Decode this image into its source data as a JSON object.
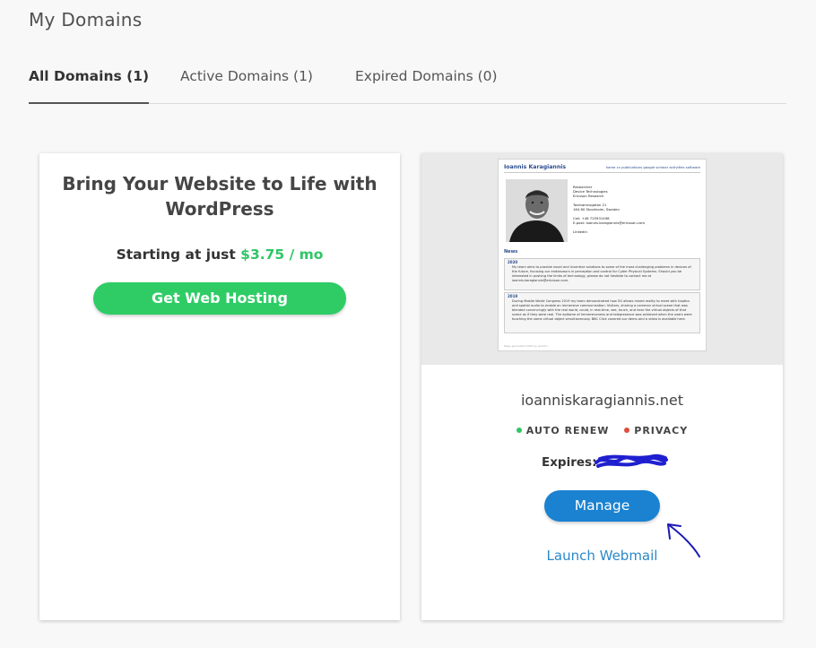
{
  "page": {
    "title": "My Domains"
  },
  "tabs": [
    {
      "label": "All Domains (1)",
      "active": true
    },
    {
      "label": "Active Domains (1)",
      "active": false
    },
    {
      "label": "Expired Domains (0)",
      "active": false
    }
  ],
  "promo": {
    "heading": "Bring Your Website to Life with WordPress",
    "price_prefix": "Starting at just",
    "price_amount": "$3.75 / mo",
    "button_label": "Get Web Hosting",
    "accent_color": "#2fcc66"
  },
  "domain_card": {
    "domain": "ioanniskaragiannis.net",
    "badges": [
      {
        "label": "AUTO RENEW",
        "color": "#2fc666"
      },
      {
        "label": "PRIVACY",
        "color": "#e04c3c"
      }
    ],
    "expires_label": "Expires:",
    "manage_label": "Manage",
    "webmail_label": "Launch Webmail",
    "manage_color": "#1a82d1"
  },
  "site_preview": {
    "name": "Ioannis Karagiannis",
    "nav": "home   cv   publications   google scholar   activities   software",
    "info": "Researcher\nDevice Technologies\nEricsson Research\n\nTorshamnsgatan 21\n164 80 Stockholm, Sweden\n\nCell: +46 725931498\nE-post: ioannis.karagiannis@ericsson.com\n\nLinkedin",
    "news_heading": "News",
    "news": [
      {
        "year": "2020",
        "text": "My team aims to provide novel and inventive solutions to some of the most challenging problems in devices of the future, focusing our endeavours in perception and control for Cyber Physical Systems. Should you be interested in pushing the limits of technology, please do not hesitate to contact me at ioannis.karagiannis@ericsson.com."
      },
      {
        "year": "2019",
        "text": "During Mobile World Congress 2019 my team demonstrated how 5G allows mixed reality to meet with haptics and spatial audio to enable an immersive communication. Visitors, sharing a common virtual scene that was blended convincingly with the real world, could, in real-time, see, touch, and hear the virtual objects of that scene as if they were real. The epitome of immersiveness and telepresence was achieved when the users were touching the same virtual object simultaneously. BBC Click covered our demo and a video is available here."
      }
    ],
    "footer": "Page generated 2020 by jemdoc."
  }
}
